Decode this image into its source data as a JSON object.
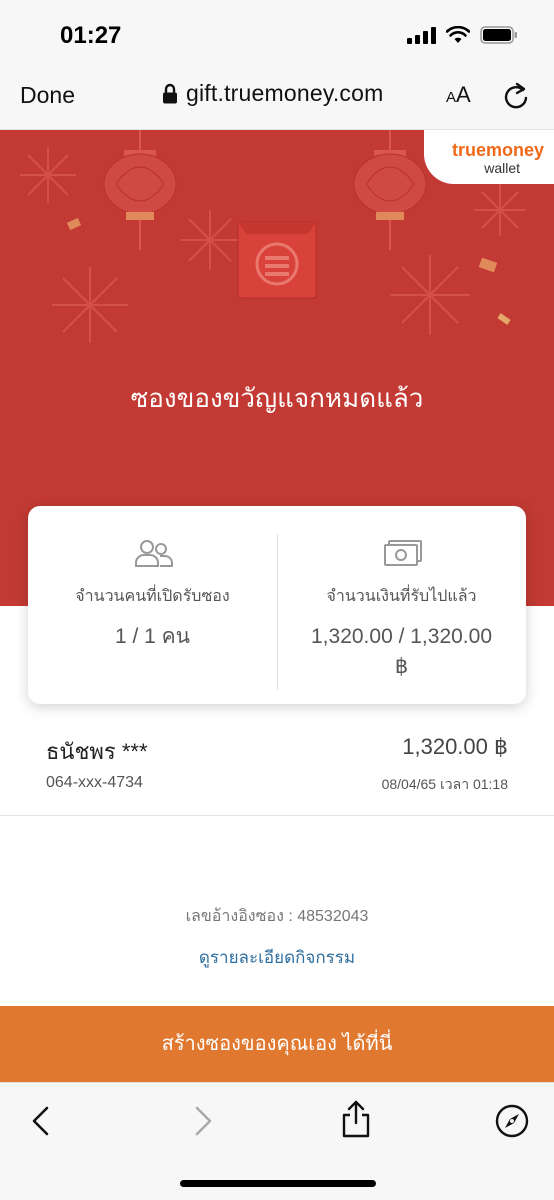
{
  "status_bar": {
    "time": "01:27"
  },
  "browser": {
    "done_label": "Done",
    "url": "gift.truemoney.com",
    "text_size_label": "AA"
  },
  "hero": {
    "brand": {
      "name": "truemoney",
      "sub": "wallet",
      "accent": "#f06a1a"
    },
    "background": "#c23a33",
    "title": "ซองของขวัญแจกหมดแล้ว"
  },
  "stats": {
    "people": {
      "label": "จำนวนคนที่เปิดรับซอง",
      "value": "1 / 1 คน",
      "icon": "people-icon"
    },
    "amount": {
      "label": "จำนวนเงินที่รับไปแล้ว",
      "value_line1": "1,320.00  /  1,320.00",
      "value_line2": "฿",
      "icon": "banknote-icon"
    }
  },
  "recipients": [
    {
      "name": "ธนัชพร ***",
      "phone": "064-xxx-4734",
      "amount": "1,320.00 ฿",
      "time": "08/04/65 เวลา 01:18"
    }
  ],
  "reference": "เลขอ้างอิงซอง : 48532043",
  "detail_link": "ดูรายละเอียดกิจกรรม",
  "cta": {
    "label": "สร้างซองของคุณเอง ได้ที่นี่",
    "color": "#e0782f"
  }
}
